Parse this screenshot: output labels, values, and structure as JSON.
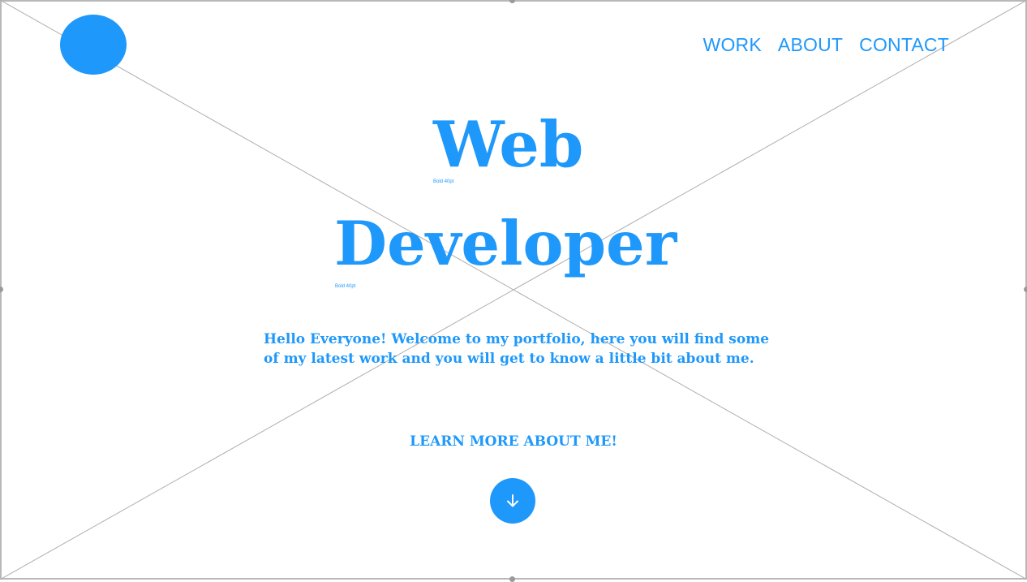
{
  "nav": {
    "items": [
      {
        "label": "WORK"
      },
      {
        "label": "ABOUT"
      },
      {
        "label": "CONTACT"
      }
    ]
  },
  "hero": {
    "title_line1": "Web",
    "title_line2": "Developer",
    "title_line1_note": "Bold 40pt",
    "title_line2_note": "Bold 40pt",
    "intro": "Hello Everyone! Welcome to my portfolio, here you will find some of my latest work and you will get to know a little bit about me.",
    "cta_label": "LEARN MORE ABOUT ME!"
  },
  "icons": {
    "logo": "logo-circle",
    "scroll": "arrow-down-icon"
  },
  "colors": {
    "accent": "#1e98fa",
    "wireframe_line": "#b0b0b0",
    "background": "#ffffff"
  }
}
